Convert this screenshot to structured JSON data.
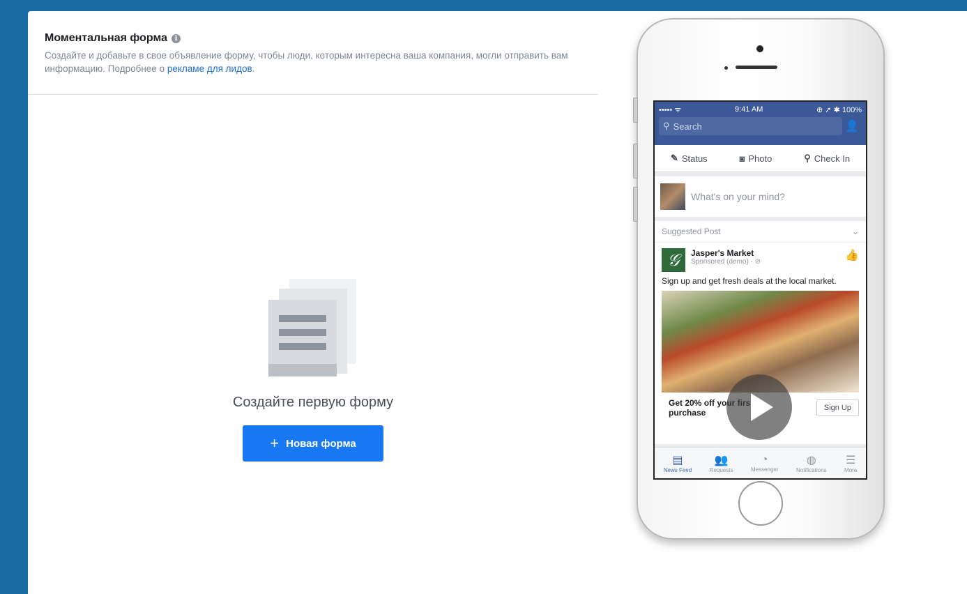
{
  "form": {
    "title": "Моментальная форма",
    "info_icon": "i",
    "description": "Создайте и добавьте в свое объявление форму, чтобы люди, которым интересна ваша компания, могли отправить вам информацию. Подробнее о ",
    "link_text": "рекламе для лидов",
    "link_suffix": "."
  },
  "empty_state": {
    "icon": "form-stack-icon",
    "text": "Создайте первую форму",
    "button_plus": "+",
    "button_label": "Новая форма"
  },
  "phone": {
    "statusbar": {
      "left": "••••• ᯤ",
      "time": "9:41 AM",
      "right": "⊕ ➚ ✱ 100%"
    },
    "search_placeholder": "Search",
    "actions": [
      {
        "icon": "✎",
        "label": "Status"
      },
      {
        "icon": "◙",
        "label": "Photo"
      },
      {
        "icon": "⚲",
        "label": "Check In"
      }
    ],
    "composer_placeholder": "What's on your mind?",
    "suggested": "Suggested Post",
    "author": "Jasper's Market",
    "sponsored": "Sponsored (demo) · ⊘",
    "post_text": "Sign up and get fresh deals at the local market.",
    "cta_text": "Get 20% off your first purchase",
    "cta_button": "Sign Up",
    "tabs": [
      {
        "icon": "▤",
        "label": "News Feed"
      },
      {
        "icon": "👥",
        "label": "Requests"
      },
      {
        "icon": "◔",
        "label": "Messenger"
      },
      {
        "icon": "◍",
        "label": "Notifications"
      },
      {
        "icon": "☰",
        "label": "More"
      }
    ]
  },
  "colors": {
    "accent": "#1877f2",
    "frame": "#1a6aa6",
    "fb_blue": "#3b5998"
  }
}
